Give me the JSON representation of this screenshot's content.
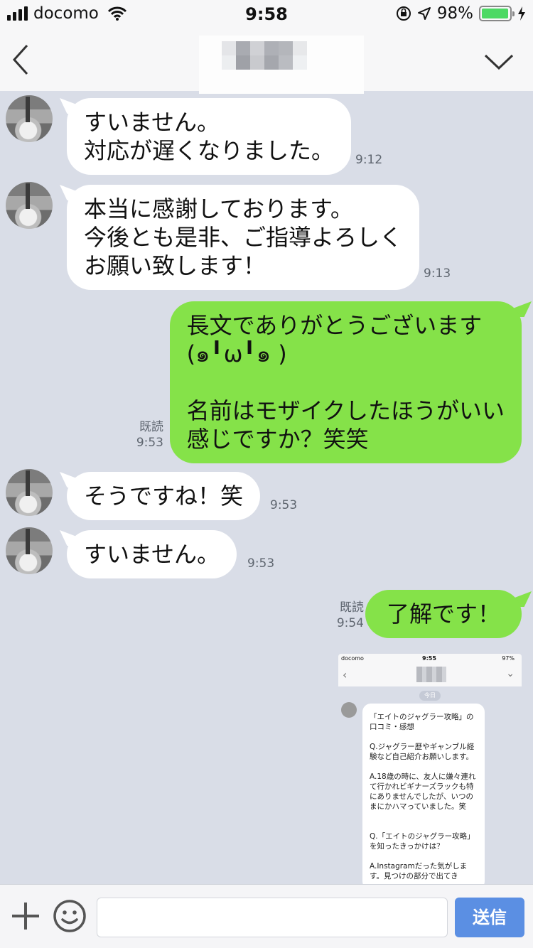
{
  "status_bar": {
    "carrier": "docomo",
    "time": "9:58",
    "battery": "98%",
    "battery_level": 0.98,
    "icons": [
      "signal-icon",
      "wifi-icon",
      "orientation-lock-icon",
      "location-icon",
      "battery-icon",
      "charging-icon"
    ]
  },
  "header": {
    "title_mosaic": true,
    "back_icon": "chevron-left-icon",
    "menu_icon": "chevron-down-icon"
  },
  "messages": [
    {
      "side": "in",
      "text": "すいません。\n対応が遅くなりました。",
      "time": "9:12",
      "read": ""
    },
    {
      "side": "in",
      "text": "本当に感謝しております。\n今後とも是非、ご指導よろしく\nお願い致します！",
      "time": "9:13",
      "read": ""
    },
    {
      "side": "out",
      "text": "長文でありがとうございます\n(๑╹ω╹๑ )\n\n名前はモザイクしたほうがいい\n感じですか？笑笑",
      "time": "9:53",
      "read": "既読"
    },
    {
      "side": "in",
      "text": "そうですね！笑",
      "time": "9:53",
      "read": ""
    },
    {
      "side": "in",
      "text": "すいません。",
      "time": "9:53",
      "read": ""
    },
    {
      "side": "out",
      "text": "了解です！",
      "time": "9:54",
      "read": "既読"
    }
  ],
  "shared_image": {
    "carrier": "docomo",
    "time": "9:55",
    "battery": "97%",
    "date_label": "今日",
    "text": "「エイトのジャグラー攻略」の\n口コミ・感想\n\nQ.ジャグラー歴やギャンブル経\n験など自己紹介お願いします。\n\nA.18歳の時に、友人に嫌々連れ\nて行かれビギナーズラックも特\nにありませんでしたが、いつの\nまにかハマっていました。笑\n\n\nQ.「エイトのジャグラー攻略」\nを知ったきっかけは？\n\nA.Instagramだった気がしま\nす。見つけの部分で出てき"
  },
  "input_bar": {
    "placeholder": "",
    "send_label": "送信",
    "icons": [
      "plus-icon",
      "smiley-icon"
    ]
  },
  "colors": {
    "background": "#d9dde7",
    "incoming_bubble": "#ffffff",
    "outgoing_bubble": "#85e249",
    "send_button": "#5b8fe3",
    "battery_fill": "#4cd964"
  }
}
